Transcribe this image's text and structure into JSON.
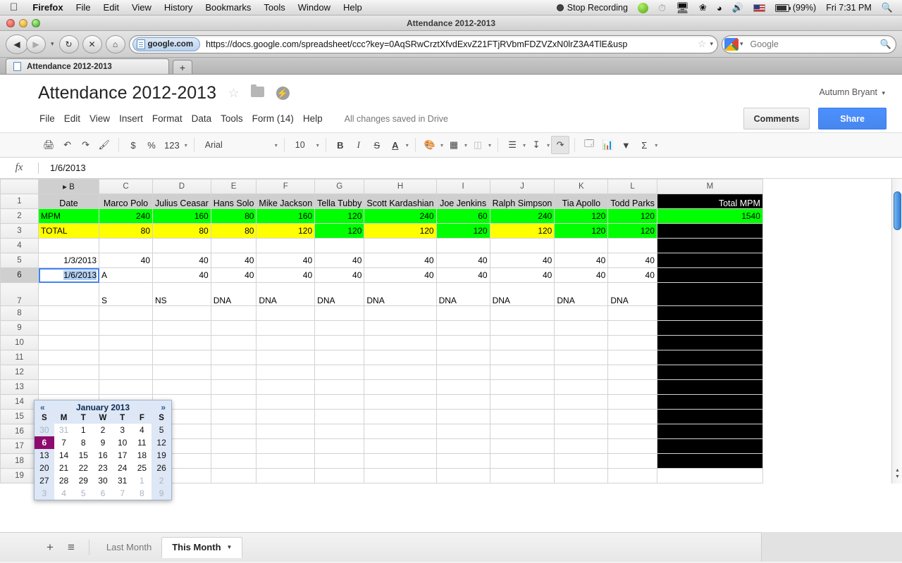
{
  "os_menubar": {
    "apple_icon": "apple-icon",
    "items": [
      "Firefox",
      "File",
      "Edit",
      "View",
      "History",
      "Bookmarks",
      "Tools",
      "Window",
      "Help"
    ],
    "status": {
      "recording": "Stop Recording",
      "battery": "(99%)",
      "clock": "Fri 7:31 PM"
    }
  },
  "browser": {
    "window_title": "Attendance 2012-2013",
    "identity": "google.com",
    "url": "https://docs.google.com/spreadsheet/ccc?key=0AqSRwCrztXfvdExvZ21FTjRVbmFDZVZxN0lrZ3A4TlE&usp",
    "search_placeholder": "Google",
    "tab_title": "Attendance 2012-2013",
    "newtab_label": "+"
  },
  "doc": {
    "title": "Attendance 2012-2013",
    "menus": [
      "File",
      "Edit",
      "View",
      "Insert",
      "Format",
      "Data",
      "Tools",
      "Form (14)",
      "Help"
    ],
    "save_status": "All changes saved in Drive",
    "user": "Autumn Bryant",
    "comments_label": "Comments",
    "share_label": "Share"
  },
  "toolbar": {
    "currency": "$",
    "percent": "%",
    "number_format": "123",
    "font": "Arial",
    "font_size": "10",
    "bold": "B",
    "italic": "I",
    "strikethrough": "S",
    "text_color": "A"
  },
  "formula_bar": {
    "fx": "fx",
    "value": "1/6/2013"
  },
  "grid": {
    "column_headers": [
      "B",
      "C",
      "D",
      "E",
      "F",
      "G",
      "H",
      "I",
      "J",
      "K",
      "L",
      "M"
    ],
    "row_headers": [
      "1",
      "2",
      "3",
      "4",
      "5",
      "6",
      "7",
      "8",
      "9",
      "10",
      "11",
      "12",
      "13",
      "14",
      "15",
      "16",
      "17",
      "18",
      "19"
    ],
    "selected_column": "B",
    "selected_row": "6",
    "headers_row": {
      "label": "Date",
      "names": [
        "Marco Polo",
        "Julius Ceasar",
        "Hans Solo",
        "Mike Jackson",
        "Tella Tubby",
        "Scott Kardashian",
        "Joe Jenkins",
        "Ralph Simpson",
        "Tia Apollo",
        "Todd Parks"
      ],
      "total": "Total MPM"
    },
    "mpm_row": {
      "label": "MPM",
      "values": [
        "240",
        "160",
        "80",
        "160",
        "120",
        "240",
        "60",
        "240",
        "120",
        "120"
      ],
      "total": "1540",
      "fills": [
        "green",
        "green",
        "green",
        "green",
        "green",
        "green",
        "green",
        "green",
        "green",
        "green"
      ]
    },
    "total_row": {
      "label": "TOTAL",
      "values": [
        "80",
        "80",
        "80",
        "120",
        "120",
        "120",
        "120",
        "120",
        "120",
        "120"
      ],
      "total": "",
      "fills": [
        "yellow",
        "yellow",
        "yellow",
        "yellow",
        "green",
        "yellow",
        "green",
        "yellow",
        "green",
        "green"
      ]
    },
    "data_rows": [
      {
        "date": "1/3/2013",
        "values": [
          "40",
          "40",
          "40",
          "40",
          "40",
          "40",
          "40",
          "40",
          "40",
          "40"
        ]
      },
      {
        "date": "1/6/2013",
        "values": [
          "A",
          "40",
          "40",
          "40",
          "40",
          "40",
          "40",
          "40",
          "40",
          "40"
        ]
      },
      {
        "date": "",
        "values": [
          "S",
          "NS",
          "DNA",
          "DNA",
          "DNA",
          "DNA",
          "DNA",
          "DNA",
          "DNA",
          "DNA"
        ]
      }
    ]
  },
  "datepicker": {
    "prev": "«",
    "next": "»",
    "title": "January 2013",
    "weekdays": [
      "S",
      "M",
      "T",
      "W",
      "T",
      "F",
      "S"
    ],
    "selected_day": "6",
    "weeks": [
      [
        {
          "d": "30",
          "out": true
        },
        {
          "d": "31",
          "out": true
        },
        {
          "d": "1"
        },
        {
          "d": "2"
        },
        {
          "d": "3"
        },
        {
          "d": "4"
        },
        {
          "d": "5"
        }
      ],
      [
        {
          "d": "6",
          "today": true
        },
        {
          "d": "7"
        },
        {
          "d": "8"
        },
        {
          "d": "9"
        },
        {
          "d": "10"
        },
        {
          "d": "11"
        },
        {
          "d": "12"
        }
      ],
      [
        {
          "d": "13"
        },
        {
          "d": "14"
        },
        {
          "d": "15"
        },
        {
          "d": "16"
        },
        {
          "d": "17"
        },
        {
          "d": "18"
        },
        {
          "d": "19"
        }
      ],
      [
        {
          "d": "20"
        },
        {
          "d": "21"
        },
        {
          "d": "22"
        },
        {
          "d": "23"
        },
        {
          "d": "24"
        },
        {
          "d": "25"
        },
        {
          "d": "26"
        }
      ],
      [
        {
          "d": "27"
        },
        {
          "d": "28"
        },
        {
          "d": "29"
        },
        {
          "d": "30"
        },
        {
          "d": "31"
        },
        {
          "d": "1",
          "out": true
        },
        {
          "d": "2",
          "out": true
        }
      ],
      [
        {
          "d": "3",
          "out": true
        },
        {
          "d": "4",
          "out": true
        },
        {
          "d": "5",
          "out": true
        },
        {
          "d": "6",
          "out": true
        },
        {
          "d": "7",
          "out": true
        },
        {
          "d": "8",
          "out": true
        },
        {
          "d": "9",
          "out": true
        }
      ]
    ]
  },
  "sheet_tabs": {
    "add": "+",
    "list": "≡",
    "tabs": [
      "Last Month",
      "This Month"
    ],
    "active": "This Month"
  },
  "colors": {
    "accent_blue": "#4d90fe",
    "mpm_green": "#00ff00",
    "total_yellow": "#ffff00",
    "black_col": "#000000",
    "today_purple": "#8e0b6e"
  }
}
